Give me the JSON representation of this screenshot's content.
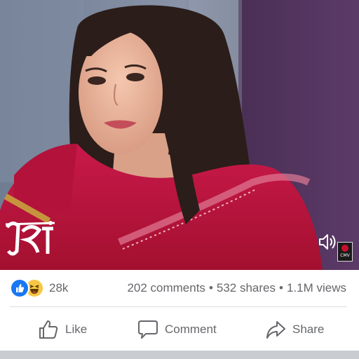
{
  "video": {
    "watermark_icon": "channel-logo-icon",
    "volume_icon": "speaker-volume-icon",
    "badge_text": "CMV"
  },
  "reactions": {
    "icons": [
      "like-icon",
      "haha-icon"
    ],
    "count": "28k"
  },
  "stats": {
    "comments": "202 comments",
    "separator": "•",
    "shares": "532 shares",
    "views": "1.1M views"
  },
  "actions": {
    "like_label": "Like",
    "comment_label": "Comment",
    "share_label": "Share"
  },
  "colors": {
    "like_blue": "#1877f2",
    "haha_yellow": "#f7c744",
    "secondary_text": "#65676b",
    "saree_red": "#c4173e"
  }
}
